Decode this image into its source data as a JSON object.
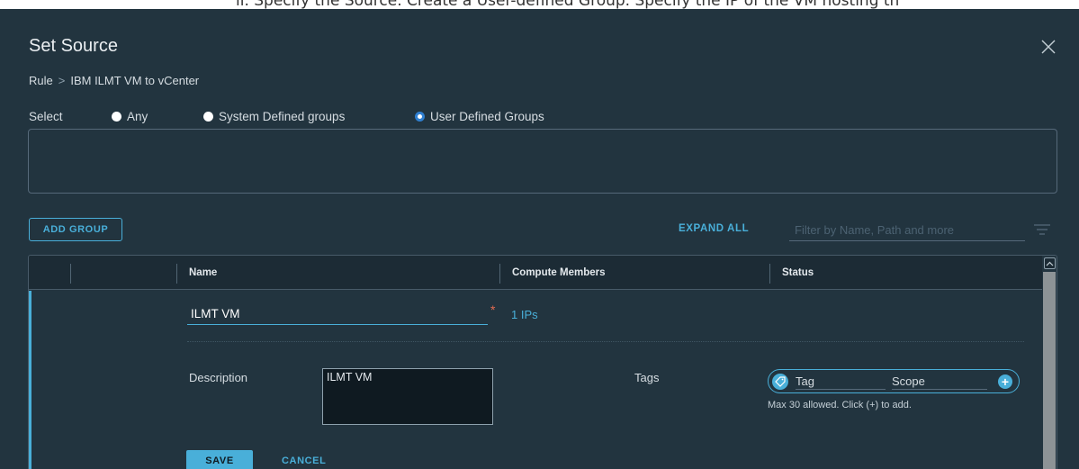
{
  "doc": {
    "text": "ii.  Specify the Source. Create a User-defined Group. Specify the IP of the VM hosting th"
  },
  "dialog": {
    "title": "Set Source",
    "close_icon": "close-icon"
  },
  "breadcrumb": {
    "root": "Rule",
    "separator": ">",
    "current": "IBM ILMT VM to vCenter"
  },
  "select": {
    "label": "Select",
    "options": [
      {
        "label": "Any",
        "selected": false
      },
      {
        "label": "System Defined groups",
        "selected": false
      },
      {
        "label": "User Defined Groups",
        "selected": true
      }
    ]
  },
  "toolbar": {
    "add_group_label": "ADD GROUP",
    "expand_all_label": "EXPAND ALL",
    "filter_placeholder": "Filter by Name, Path and more",
    "filter_icon": "filter-icon"
  },
  "table": {
    "columns": [
      "Name",
      "Compute Members",
      "Status"
    ]
  },
  "edit_row": {
    "name_value": "ILMT VM",
    "required_mark": "*",
    "compute_members": "1 IPs",
    "description_label": "Description",
    "description_value": "ILMT VM",
    "tags_label": "Tags",
    "tag_placeholder": "Tag",
    "scope_placeholder": "Scope",
    "tags_help": "Max 30 allowed. Click (+) to add.",
    "save_label": "SAVE",
    "cancel_label": "CANCEL"
  },
  "colors": {
    "background": "#22343f",
    "accent": "#49afd9",
    "required": "#e36b52"
  }
}
